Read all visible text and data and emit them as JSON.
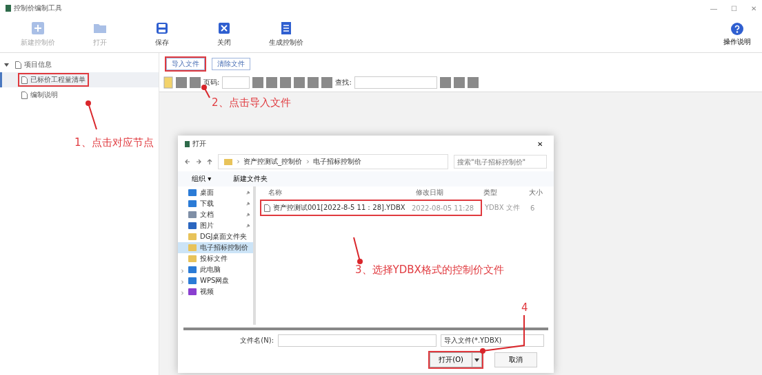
{
  "window": {
    "title": "控制价编制工具",
    "controls": [
      "—",
      "☐",
      "✕"
    ]
  },
  "toolbar": [
    {
      "label": "新建控制价",
      "disabled": true,
      "kind": "plus"
    },
    {
      "label": "打开",
      "disabled": true,
      "kind": "folder"
    },
    {
      "label": "保存",
      "disabled": false,
      "kind": "save"
    },
    {
      "label": "关闭",
      "disabled": false,
      "kind": "close"
    },
    {
      "label": "生成控制价",
      "disabled": false,
      "kind": "doc"
    }
  ],
  "help": {
    "label": "操作说明"
  },
  "tree": [
    {
      "label": "项目信息",
      "expanded": true,
      "selected": false,
      "highlighted": false,
      "children": [
        {
          "label": "已标价工程量清单",
          "selected": true,
          "highlighted": true
        },
        {
          "label": "编制说明",
          "selected": false,
          "highlighted": false
        }
      ]
    }
  ],
  "file_buttons": [
    {
      "label": "导入文件",
      "highlighted": true
    },
    {
      "label": "清除文件",
      "highlighted": false
    }
  ],
  "viewer_bar": {
    "page_label": "页码:",
    "find_label": "查找:"
  },
  "annotations": [
    {
      "text": "1、点击对应节点"
    },
    {
      "text": "2、点击导入文件"
    },
    {
      "text": "3、选择YDBX格式的控制价文件"
    },
    {
      "text": "4"
    }
  ],
  "dialog": {
    "title": "打开",
    "close": "✕",
    "path": [
      "资产控测试_控制价",
      "电子招标控制价"
    ],
    "search": {
      "placeholder": "搜索\"电子招标控制价\""
    },
    "commands": [
      "组织 ▾",
      "新建文件夹"
    ],
    "nav": [
      {
        "label": "桌面",
        "kind": "desktop",
        "selected": false,
        "pinned": true,
        "expander": false
      },
      {
        "label": "下载",
        "kind": "download",
        "selected": false,
        "pinned": true,
        "expander": false
      },
      {
        "label": "文档",
        "kind": "doc",
        "selected": false,
        "pinned": true,
        "expander": false
      },
      {
        "label": "图片",
        "kind": "image",
        "selected": false,
        "pinned": true,
        "expander": false
      },
      {
        "label": "DGJ桌面文件夹",
        "kind": "folder",
        "selected": false,
        "pinned": false,
        "expander": false
      },
      {
        "label": "电子招标控制价",
        "kind": "folder",
        "selected": true,
        "pinned": false,
        "expander": false
      },
      {
        "label": "投标文件",
        "kind": "folder",
        "selected": false,
        "pinned": false,
        "expander": false
      },
      {
        "label": "此电脑",
        "kind": "pc",
        "selected": false,
        "pinned": false,
        "expander": true
      },
      {
        "label": "WPS网盘",
        "kind": "cloud",
        "selected": false,
        "pinned": false,
        "expander": true
      },
      {
        "label": "视频",
        "kind": "video",
        "selected": false,
        "pinned": false,
        "expander": true
      }
    ],
    "columns": [
      "名称",
      "修改日期",
      "类型",
      "大小"
    ],
    "files": [
      {
        "name": "资产控测试001[2022-8-5 11：28].YDBX",
        "modified": "2022-08-05 11:28",
        "type": "YDBX 文件",
        "size": "6",
        "highlighted": true
      }
    ],
    "filename_label": "文件名(N):",
    "filter": "导入文件(*.YDBX)",
    "open_button": {
      "label": "打开(O)",
      "highlighted": true
    },
    "cancel_button": {
      "label": "取消"
    }
  }
}
